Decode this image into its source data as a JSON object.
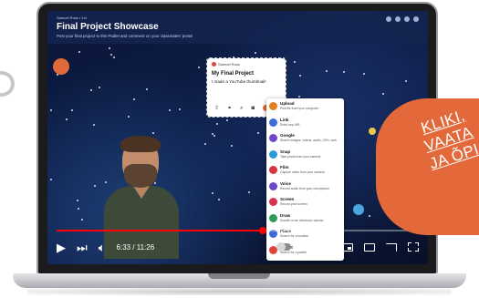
{
  "padlet": {
    "author_line": "Samuel Ross • 1m",
    "title": "Final Project Showcase",
    "description": "Post your final project to this Padlet and comment on your classmates' posts!"
  },
  "post_card": {
    "author": "Samuel Ross",
    "title": "My Final Project",
    "body": "I made a YouTube thumbnail!"
  },
  "attachment_menu": [
    {
      "label": "Upload",
      "sub": "Pick file from your computer",
      "color": "#e67e22",
      "icon": "upload-icon"
    },
    {
      "label": "Link",
      "sub": "Enter any URL",
      "color": "#3b6bd6",
      "icon": "link-icon"
    },
    {
      "label": "Google",
      "sub": "Search images, videos, audio, GIFs, web",
      "color": "#6f49c9",
      "icon": "google-icon"
    },
    {
      "label": "Snap",
      "sub": "Take photo from your camera",
      "color": "#2b9bd6",
      "icon": "camera-icon"
    },
    {
      "label": "Film",
      "sub": "Capture video from your camera",
      "color": "#d6343f",
      "icon": "film-icon"
    },
    {
      "label": "Voice",
      "sub": "Record audio from your microphone",
      "color": "#6c47c9",
      "icon": "microphone-icon"
    },
    {
      "label": "Screen",
      "sub": "Record your screen",
      "color": "#d6344e",
      "icon": "screen-icon"
    },
    {
      "label": "Draw",
      "sub": "Doodle on an electronic canvas",
      "color": "#2f9b58",
      "icon": "pencil-icon"
    },
    {
      "label": "Place",
      "sub": "Search for a location",
      "color": "#3b6bd6",
      "icon": "pin-icon"
    },
    {
      "label": "Padlet",
      "sub": "Search for a padlet",
      "color": "#e0453a",
      "icon": "padlet-icon"
    }
  ],
  "player": {
    "time": "6:33 / 11:26",
    "progress_fraction": 0.57,
    "accent": "#ff0000"
  },
  "badge": {
    "lines": [
      "KLIKI,",
      "VAATA",
      "JA ÕPI"
    ],
    "color": "#e4693a"
  }
}
